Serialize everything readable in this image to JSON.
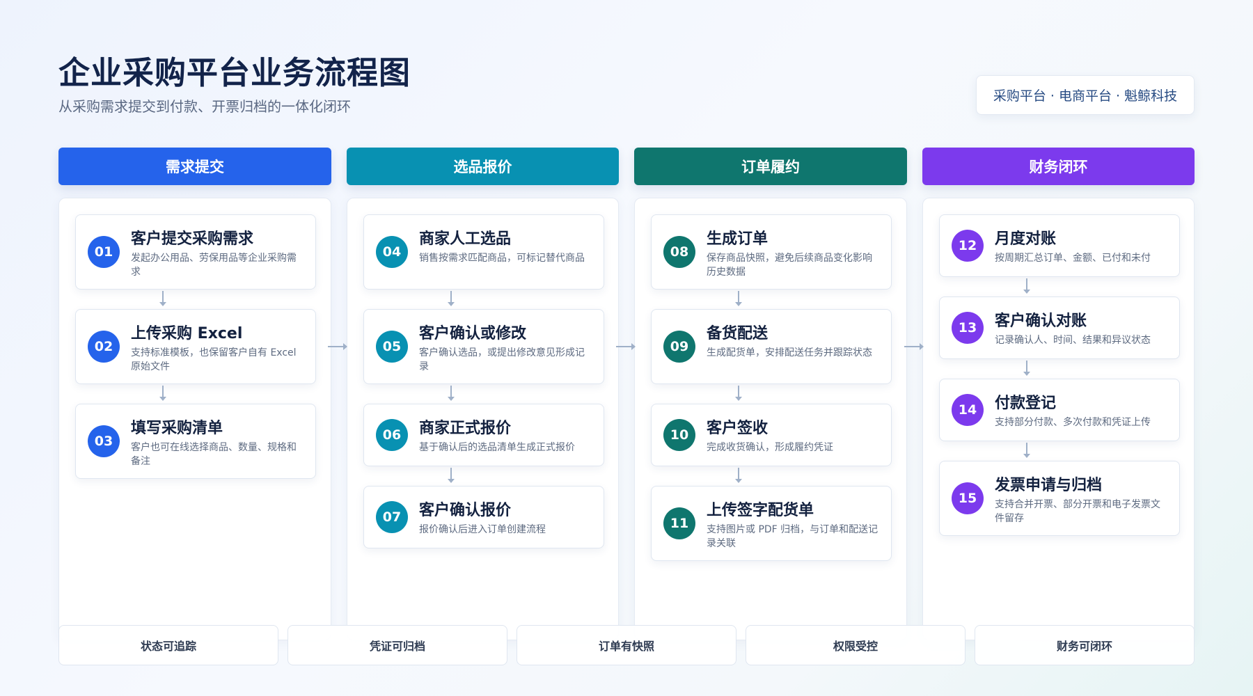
{
  "title": "企业采购平台业务流程图",
  "subtitle": "从采购需求提交到付款、开票归档的一体化闭环",
  "brand_badge": "采购平台 · 电商平台 · 魁鲸科技",
  "colors": {
    "lane1": "#2563eb",
    "lane2": "#0891b2",
    "lane3": "#0f766e",
    "lane4": "#7c3aed",
    "connector": "#9fb0c8"
  },
  "lanes": [
    {
      "name": "需求提交",
      "steps": [
        {
          "num": "01",
          "title": "客户提交采购需求",
          "desc": "发起办公用品、劳保用品等企业采购需求"
        },
        {
          "num": "02",
          "title": "上传采购 Excel",
          "desc": "支持标准模板，也保留客户自有 Excel 原始文件"
        },
        {
          "num": "03",
          "title": "填写采购清单",
          "desc": "客户也可在线选择商品、数量、规格和备注"
        }
      ]
    },
    {
      "name": "选品报价",
      "steps": [
        {
          "num": "04",
          "title": "商家人工选品",
          "desc": "销售按需求匹配商品，可标记替代商品"
        },
        {
          "num": "05",
          "title": "客户确认或修改",
          "desc": "客户确认选品，或提出修改意见形成记录"
        },
        {
          "num": "06",
          "title": "商家正式报价",
          "desc": "基于确认后的选品清单生成正式报价"
        },
        {
          "num": "07",
          "title": "客户确认报价",
          "desc": "报价确认后进入订单创建流程"
        }
      ]
    },
    {
      "name": "订单履约",
      "steps": [
        {
          "num": "08",
          "title": "生成订单",
          "desc": "保存商品快照，避免后续商品变化影响历史数据"
        },
        {
          "num": "09",
          "title": "备货配送",
          "desc": "生成配货单，安排配送任务并跟踪状态"
        },
        {
          "num": "10",
          "title": "客户签收",
          "desc": "完成收货确认，形成履约凭证"
        },
        {
          "num": "11",
          "title": "上传签字配货单",
          "desc": "支持图片或 PDF 归档，与订单和配送记录关联"
        }
      ]
    },
    {
      "name": "财务闭环",
      "steps": [
        {
          "num": "12",
          "title": "月度对账",
          "desc": "按周期汇总订单、金额、已付和未付"
        },
        {
          "num": "13",
          "title": "客户确认对账",
          "desc": "记录确认人、时间、结果和异议状态"
        },
        {
          "num": "14",
          "title": "付款登记",
          "desc": "支持部分付款、多次付款和凭证上传"
        },
        {
          "num": "15",
          "title": "发票申请与归档",
          "desc": "支持合并开票、部分开票和电子发票文件留存"
        }
      ]
    }
  ],
  "footer": [
    "状态可追踪",
    "凭证可归档",
    "订单有快照",
    "权限受控",
    "财务可闭环"
  ]
}
